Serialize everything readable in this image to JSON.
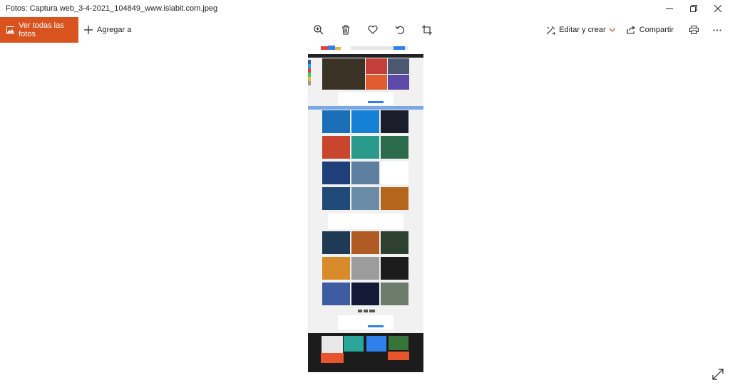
{
  "window": {
    "title": "Fotos: Captura web_3-4-2021_104849_www.islabit.com.jpeg",
    "controls": [
      "minimize-icon",
      "restore-icon",
      "close-icon"
    ]
  },
  "toolbar": {
    "view_all_label": "Ver todas las fotos",
    "add_to_label": "Agregar a",
    "center_icons": [
      "zoom-in-icon",
      "delete-icon",
      "favorite-icon",
      "rotate-icon",
      "crop-icon"
    ],
    "edit_create_label": "Editar y crear",
    "share_label": "Compartir",
    "print_icon": "print-icon",
    "more_icon": "more-icon"
  },
  "colors": {
    "accent": "#d9531f",
    "site_blue": "#2f80ed"
  },
  "viewer": {
    "expand_icon": "expand-icon"
  }
}
